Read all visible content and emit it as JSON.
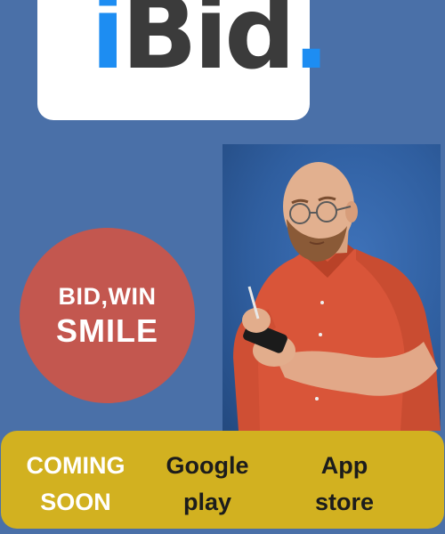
{
  "logo": {
    "letter_i": "i",
    "letters_bid": "Bid",
    "dot": "."
  },
  "slogan": {
    "line1": "BID,WIN",
    "line2": "SMILE"
  },
  "bottom_bar": {
    "coming_line1": "COMING",
    "coming_line2": "SOON",
    "google_line1": "Google",
    "google_line2": "play",
    "app_line1": "App",
    "app_line2": "store"
  },
  "colors": {
    "background": "#4a70a8",
    "logo_blue": "#1d8df2",
    "logo_dark": "#3b3b3b",
    "circle": "#c3574f",
    "bar": "#d2b120"
  }
}
